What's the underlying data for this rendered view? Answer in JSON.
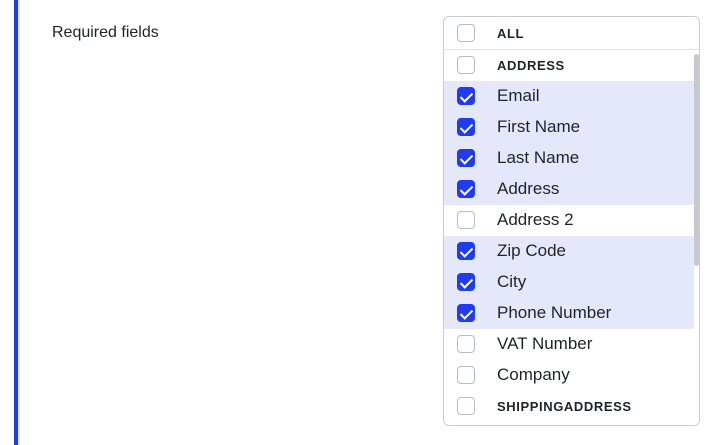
{
  "form": {
    "label": "Required fields"
  },
  "checklist": {
    "header": {
      "label": "ALL",
      "checked": false
    },
    "items": [
      {
        "label": "ADDRESS",
        "checked": false,
        "group": true
      },
      {
        "label": "Email",
        "checked": true,
        "group": false
      },
      {
        "label": "First Name",
        "checked": true,
        "group": false
      },
      {
        "label": "Last Name",
        "checked": true,
        "group": false
      },
      {
        "label": "Address",
        "checked": true,
        "group": false
      },
      {
        "label": "Address 2",
        "checked": false,
        "group": false
      },
      {
        "label": "Zip Code",
        "checked": true,
        "group": false
      },
      {
        "label": "City",
        "checked": true,
        "group": false
      },
      {
        "label": "Phone Number",
        "checked": true,
        "group": false
      },
      {
        "label": "VAT Number",
        "checked": false,
        "group": false
      },
      {
        "label": "Company",
        "checked": false,
        "group": false
      },
      {
        "label": "SHIPPINGADDRESS",
        "checked": false,
        "group": true
      }
    ]
  },
  "colors": {
    "accent": "#1f3cf0",
    "selected_row": "#e5e8fb"
  }
}
